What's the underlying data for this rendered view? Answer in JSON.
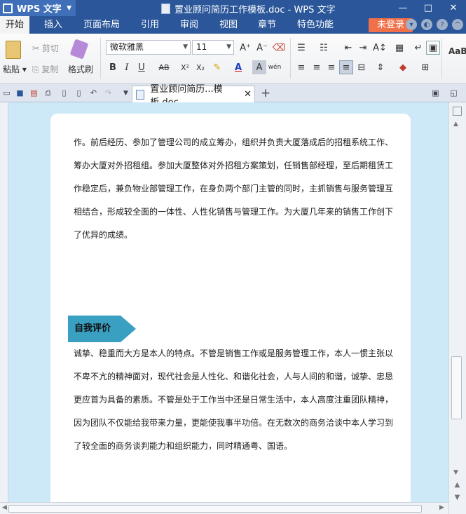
{
  "titlebar": {
    "app_name": "WPS 文字",
    "document_title": "置业顾问简历工作模板.doc - WPS 文字",
    "win_minimize": "—",
    "win_maximize": "□",
    "win_close": "✕"
  },
  "menu": {
    "tabs": [
      "开始",
      "插入",
      "页面布局",
      "引用",
      "审阅",
      "视图",
      "章节",
      "特色功能"
    ],
    "active_tab": "开始",
    "login_label": "未登录"
  },
  "ribbon": {
    "clipboard": {
      "paste_label": "粘贴",
      "cut_label": "剪切",
      "copy_label": "复制",
      "format_painter_label": "格式刷"
    },
    "font": {
      "family": "微软雅黑",
      "size": "11"
    },
    "style_preview": "AaBb"
  },
  "doc_tabs": {
    "active_tab_label": "置业顾问简历...模板.doc"
  },
  "document": {
    "paragraph_1_lines": [
      "作。前后经历、参加了管理公司的成立筹办，组织并负责大厦落成后的招租系统工作、",
      "筹办大厦对外招租组。参加大厦整体对外招租方案策划，任销售部经理，至后期租赁工",
      "作稳定后，兼负物业部管理工作，在身负两个部门主管的同时，主抓销售与服务管理互",
      "相结合，形成较全面的一体性、人性化销售与管理工作。为大厦几年来的销售工作创下",
      "了优异的成绩。"
    ],
    "section_heading": "自我评价",
    "paragraph_2_lines": [
      "诚挚、稳重而大方是本人的特点。不管是销售工作或是服务管理工作，本人一惯主张以",
      "不卑不亢的精神面对，现代社会是人性化、和谐化社会，人与人间的和谐，诚挚、忠恳",
      "更应首为具备的素质。不管是处于工作当中还是日常生活中，本人高度注重团队精神，",
      "因为团队不仅能给我带来力量，更能使我事半功倍。在无数次的商务洽谈中本人学习到",
      "了较全面的商务谈判能力和组织能力，同时精通粤、国语。"
    ]
  },
  "colors": {
    "titlebar_bg": "#2b579a",
    "login_button": "#f0704a",
    "section_tag": "#3aa0c2",
    "document_background": "#cde9f7"
  }
}
